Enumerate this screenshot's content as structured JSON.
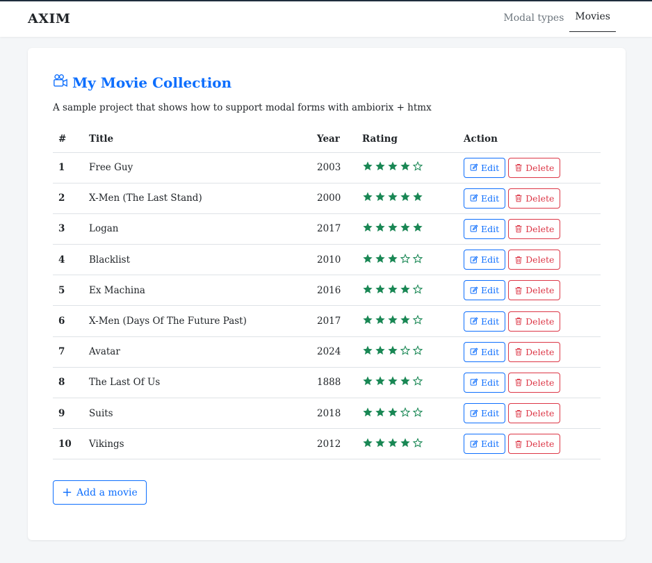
{
  "brand": "AXIM",
  "nav": [
    {
      "label": "Modal types",
      "active": false
    },
    {
      "label": "Movies",
      "active": true
    }
  ],
  "page": {
    "title": "My Movie Collection",
    "subtitle": "A sample project that shows how to support modal forms with ambiorix + htmx",
    "title_icon": "video-camera-icon"
  },
  "table": {
    "headers": [
      "#",
      "Title",
      "Year",
      "Rating",
      "Action"
    ],
    "edit_label": "Edit",
    "delete_label": "Delete",
    "max_rating": 5,
    "rows": [
      {
        "id": "1",
        "title": "Free Guy",
        "year": "2003",
        "rating": 4
      },
      {
        "id": "2",
        "title": "X-Men (The Last Stand)",
        "year": "2000",
        "rating": 5
      },
      {
        "id": "3",
        "title": "Logan",
        "year": "2017",
        "rating": 5
      },
      {
        "id": "4",
        "title": "Blacklist",
        "year": "2010",
        "rating": 3
      },
      {
        "id": "5",
        "title": "Ex Machina",
        "year": "2016",
        "rating": 4
      },
      {
        "id": "6",
        "title": "X-Men (Days Of The Future Past)",
        "year": "2017",
        "rating": 4
      },
      {
        "id": "7",
        "title": "Avatar",
        "year": "2024",
        "rating": 3
      },
      {
        "id": "8",
        "title": "The Last Of Us",
        "year": "1888",
        "rating": 4
      },
      {
        "id": "9",
        "title": "Suits",
        "year": "2018",
        "rating": 3
      },
      {
        "id": "10",
        "title": "Vikings",
        "year": "2012",
        "rating": 4
      }
    ]
  },
  "add_button": {
    "label": "Add a movie",
    "icon": "plus-icon"
  },
  "colors": {
    "primary": "#0d6efd",
    "danger": "#dc3545",
    "star": "#198754"
  }
}
